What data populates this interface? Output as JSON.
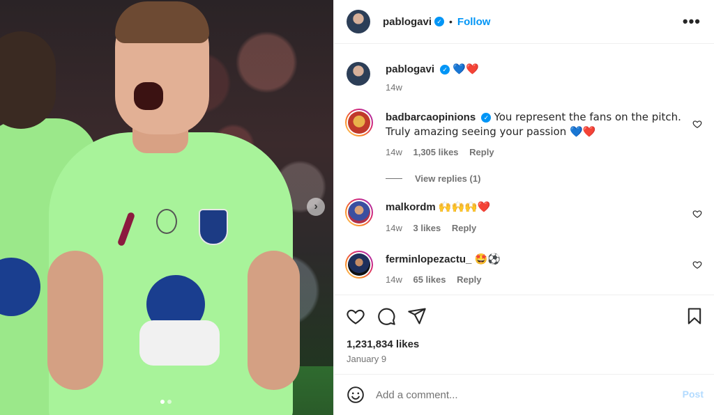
{
  "post_author": {
    "username": "pablogavi",
    "verified": true,
    "follow_label": "Follow",
    "separator": "•",
    "more_label": "•••"
  },
  "caption": {
    "username": "pablogavi",
    "text": "💙❤️",
    "time": "14w"
  },
  "comments": [
    {
      "username": "badbarcaopinions",
      "verified": true,
      "text": "You represent the fans on the pitch. Truly amazing seeing your passion 💙❤️",
      "time": "14w",
      "likes": "1,305 likes",
      "reply_label": "Reply",
      "view_replies": "View replies (1)"
    },
    {
      "username": "malkordm",
      "verified": false,
      "text": "🙌🙌🙌❤️",
      "time": "14w",
      "likes": "3 likes",
      "reply_label": "Reply"
    },
    {
      "username": "ferminlopezactu_",
      "verified": false,
      "text": "🤩⚽",
      "time": "14w",
      "likes": "65 likes",
      "reply_label": "Reply"
    }
  ],
  "post_stats": {
    "likes": "1,231,834 likes",
    "date": "January 9"
  },
  "add_comment": {
    "placeholder": "Add a comment...",
    "post_label": "Post"
  },
  "media": {
    "next_label": "›"
  },
  "icons": {
    "like": "heart-icon",
    "comment": "comment-icon",
    "share": "share-icon",
    "save": "bookmark-icon",
    "emoji": "emoji-icon",
    "verified": "verified-badge-icon"
  },
  "colors": {
    "accent": "#0095f6",
    "post_button_disabled": "#b3dbff",
    "muted_text": "#737373"
  }
}
